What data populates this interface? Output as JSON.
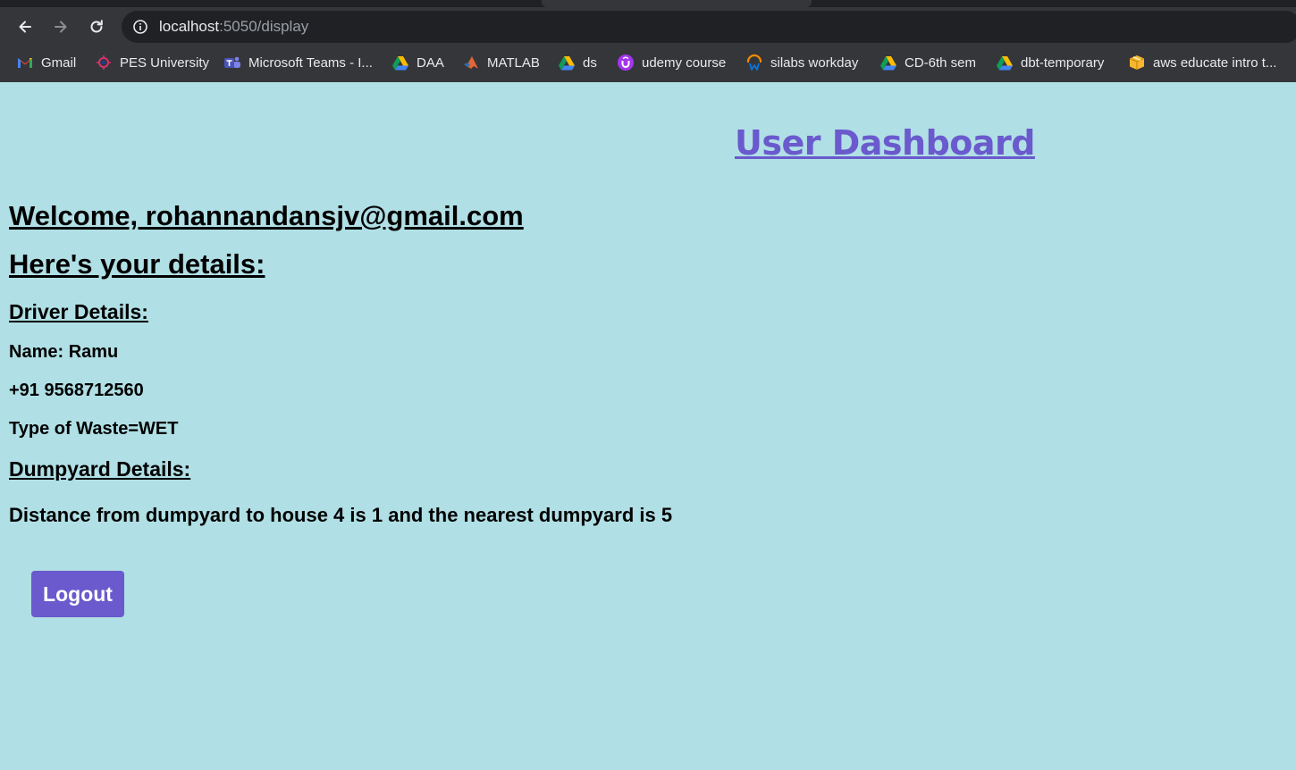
{
  "browser": {
    "url_host": "localhost",
    "url_rest": ":5050/display",
    "bookmarks": [
      {
        "label": "Gmail",
        "icon": "gmail-icon"
      },
      {
        "label": "PES University",
        "icon": "pes-icon"
      },
      {
        "label": "Microsoft Teams - I...",
        "icon": "teams-icon"
      },
      {
        "label": "DAA",
        "icon": "google-drive-icon"
      },
      {
        "label": "MATLAB",
        "icon": "matlab-icon"
      },
      {
        "label": "ds",
        "icon": "google-drive-icon"
      },
      {
        "label": "udemy course",
        "icon": "udemy-icon"
      },
      {
        "label": "silabs workday",
        "icon": "workday-icon"
      },
      {
        "label": "CD-6th sem",
        "icon": "google-drive-icon"
      },
      {
        "label": "dbt-temporary",
        "icon": "google-drive-icon"
      },
      {
        "label": "aws educate intro t...",
        "icon": "aws-box-icon"
      }
    ]
  },
  "page": {
    "title": "User Dashboard",
    "welcome": "Welcome, rohannandansjv@gmail.com",
    "details_heading": "Here's your details:",
    "driver_heading": "Driver Details:",
    "driver_name": "Name: Ramu",
    "driver_phone": "+91 9568712560",
    "waste_type": "Type of Waste=WET",
    "dumpyard_heading": "Dumpyard Details:",
    "distance_text": "Distance from dumpyard to house 4 is 1 and the nearest dumpyard is 5",
    "logout_label": "Logout"
  },
  "colors": {
    "page_background": "#b0dfe5",
    "accent": "#6a5acd",
    "chrome_toolbar": "#35363a",
    "omnibox": "#202124"
  }
}
